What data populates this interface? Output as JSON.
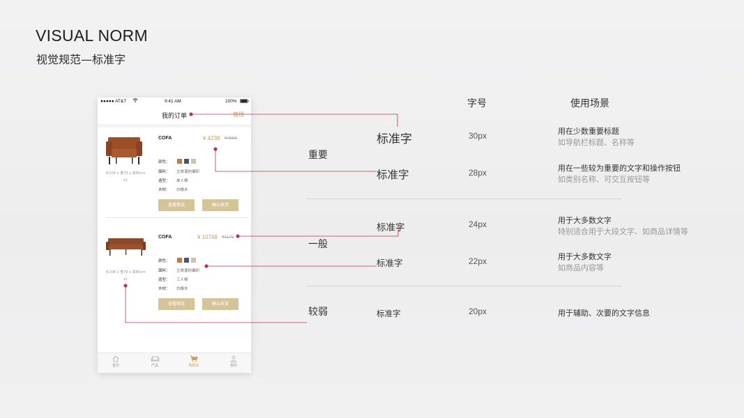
{
  "heading": {
    "title_en": "VISUAL NORM",
    "title_zh": "视觉规范—标准字"
  },
  "phone": {
    "status": {
      "carrier": "●●●●● AT&T",
      "time": "9:41 AM",
      "battery": "100%"
    },
    "nav": {
      "title": "我的订单",
      "action": "管理"
    },
    "orders": [
      {
        "dims": "长104 x 宽79 x 高85cm",
        "qty": "x1",
        "brand": "COFA",
        "price": "¥ 4238",
        "old_price": "¥4556",
        "attrs": [
          {
            "label": "颜色：",
            "value": ""
          },
          {
            "label": "面料：",
            "value": "立体混纺编织"
          },
          {
            "label": "造型：",
            "value": "单人椅"
          },
          {
            "label": "木材：",
            "value": "白橡木"
          }
        ],
        "btn_logistics": "查看物流",
        "btn_confirm": "确认收货"
      },
      {
        "dims": "长208 x 宽79 x 高85cm",
        "qty": "x1",
        "brand": "COFA",
        "price": "¥ 10748",
        "old_price": "¥1175",
        "attrs": [
          {
            "label": "颜色：",
            "value": ""
          },
          {
            "label": "面料：",
            "value": "立体混纺编织"
          },
          {
            "label": "造型：",
            "value": "三人椅"
          },
          {
            "label": "木材：",
            "value": "白橡木"
          }
        ],
        "btn_logistics": "查看物流",
        "btn_confirm": "确认收货"
      }
    ],
    "swatch_colors": [
      "#b97a4c",
      "#4f5367",
      "#c9c2b4"
    ],
    "tabs": [
      {
        "label": "首页",
        "icon": "home-icon"
      },
      {
        "label": "产品",
        "icon": "sofa-icon"
      },
      {
        "label": "购物车",
        "icon": "cart-icon"
      },
      {
        "label": "我的",
        "icon": "user-icon"
      }
    ]
  },
  "spec": {
    "header_size": "字号",
    "header_usage": "使用场景",
    "categories": {
      "important": "重要",
      "general": "一般",
      "weak": "较弱"
    },
    "rows": [
      {
        "sample": "标准字",
        "size": "30px",
        "use_main": "用在少数重要标题",
        "use_sub": "如导航栏标题、名称等"
      },
      {
        "sample": "标准字",
        "size": "28px",
        "use_main": "用在一些较为重要的文字和操作按钮",
        "use_sub": "如类别名称、可交互按钮等"
      },
      {
        "sample": "标准字",
        "size": "24px",
        "use_main": "用于大多数文字",
        "use_sub": "特别适合用于大段文字、如商品详情等"
      },
      {
        "sample": "标准字",
        "size": "22px",
        "use_main": "用于大多数文字",
        "use_sub": "如商品内容等"
      },
      {
        "sample": "标准字",
        "size": "20px",
        "use_main": "用于辅助、次要的文字信息",
        "use_sub": ""
      }
    ]
  },
  "colors": {
    "accent": "#b9374a",
    "gold": "#c9a46b",
    "button": "#d4c497"
  }
}
